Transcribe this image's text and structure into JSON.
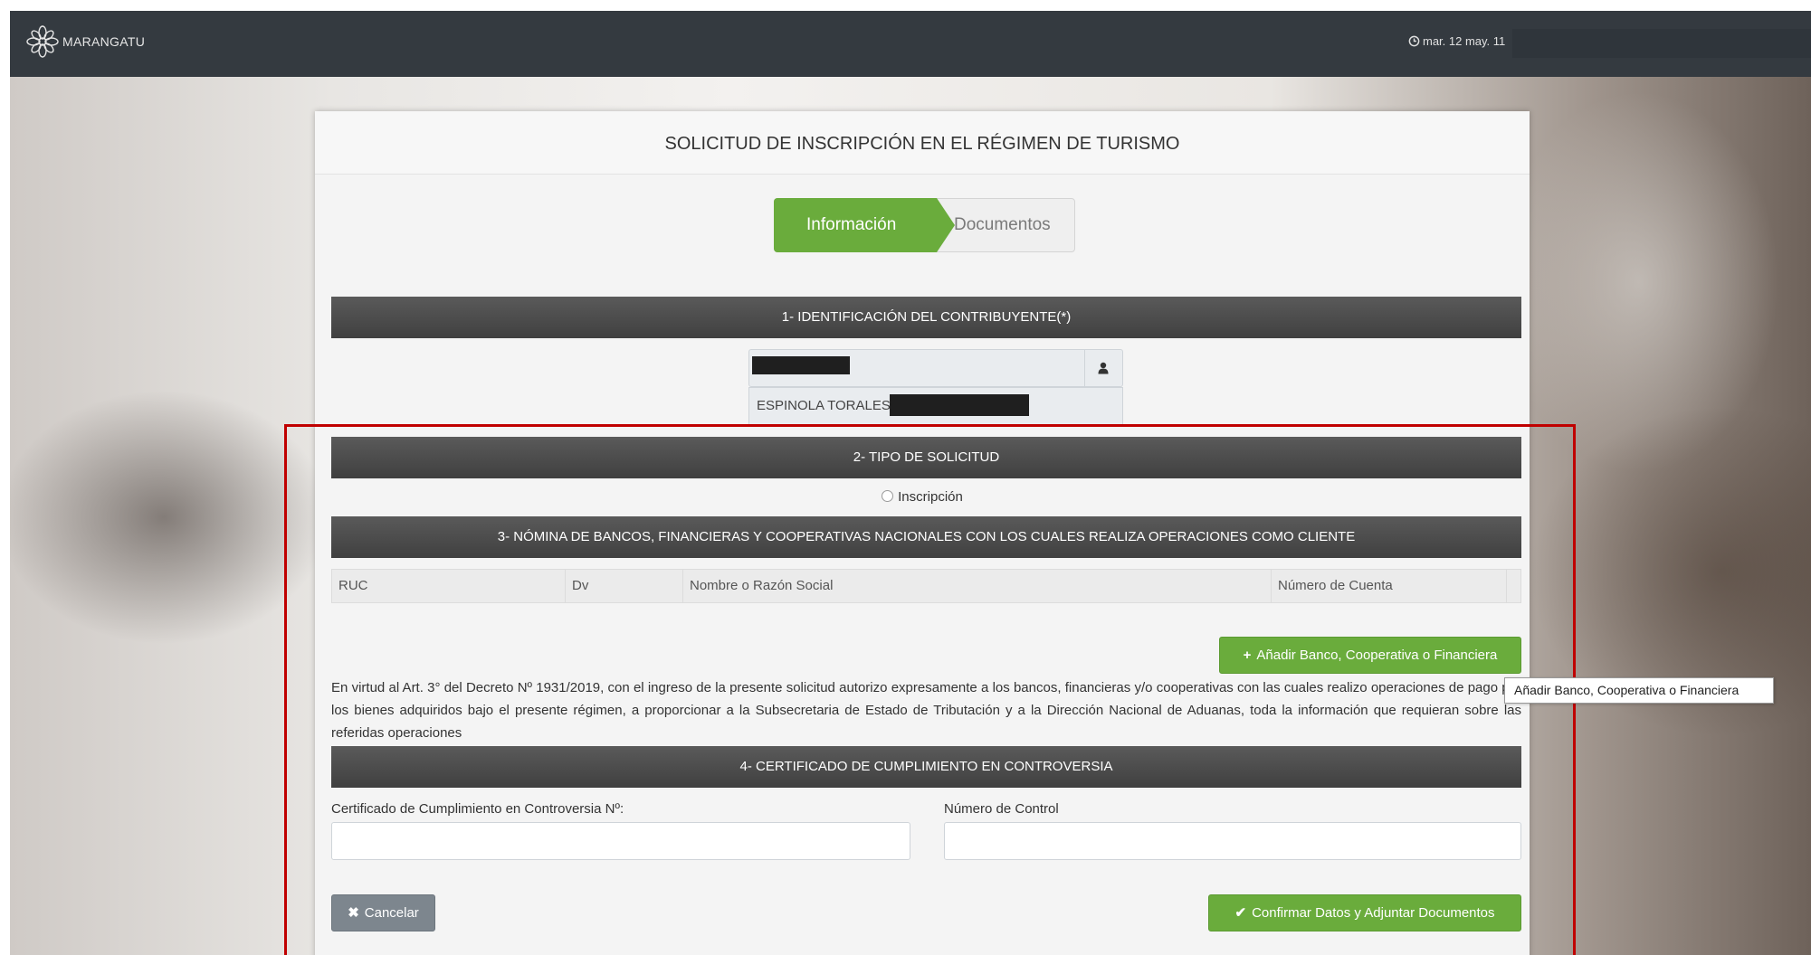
{
  "header": {
    "brand": "MARANGATU",
    "datetime": "mar. 12 may. 11"
  },
  "panel": {
    "title": "SOLICITUD DE INSCRIPCIÓN EN EL RÉGIMEN DE TURISMO",
    "steps": [
      "Información",
      "Documentos"
    ],
    "active_step": "Información"
  },
  "section1": {
    "title": "1- IDENTIFICACIÓN DEL CONTRIBUYENTE(*)",
    "name_value": "ESPINOLA TORALES",
    "user_icon": "user-icon"
  },
  "section2": {
    "title": "2- TIPO DE SOLICITUD",
    "radio_label": "Inscripción",
    "radio_checked": false
  },
  "section3": {
    "title": "3- NÓMINA DE BANCOS, FINANCIERAS Y COOPERATIVAS NACIONALES CON LOS CUALES REALIZA OPERACIONES COMO CLIENTE",
    "columns": [
      "RUC",
      "Dv",
      "Nombre o Razón Social",
      "Número de Cuenta"
    ],
    "add_button": "Añadir Banco, Cooperativa o Financiera",
    "tooltip": "Añadir Banco, Cooperativa o Financiera",
    "legal_text": "En virtud al Art. 3° del Decreto Nº 1931/2019, con el ingreso de la presente solicitud autorizo expresamente a los bancos, financieras y/o cooperativas con las cuales realizo operaciones de pago por los bienes adquiridos bajo el presente régimen, a proporcionar a la Subsecretaria de Estado de Tributación y a la Dirección Nacional de Aduanas, toda la información que requieran sobre las referidas operaciones"
  },
  "section4": {
    "title": "4- CERTIFICADO DE CUMPLIMIENTO EN CONTROVERSIA",
    "label_cert": "Certificado de Cumplimiento en Controversia Nº:",
    "label_control": "Número de Control",
    "value_cert": "",
    "value_control": ""
  },
  "footer": {
    "cancel": "Cancelar",
    "confirm": "Confirmar Datos y Adjuntar Documentos"
  },
  "colors": {
    "accent_green": "#6aac3c",
    "topbar": "#343a40",
    "section_bar": "#4a4a4a",
    "highlight": "#c00000"
  }
}
